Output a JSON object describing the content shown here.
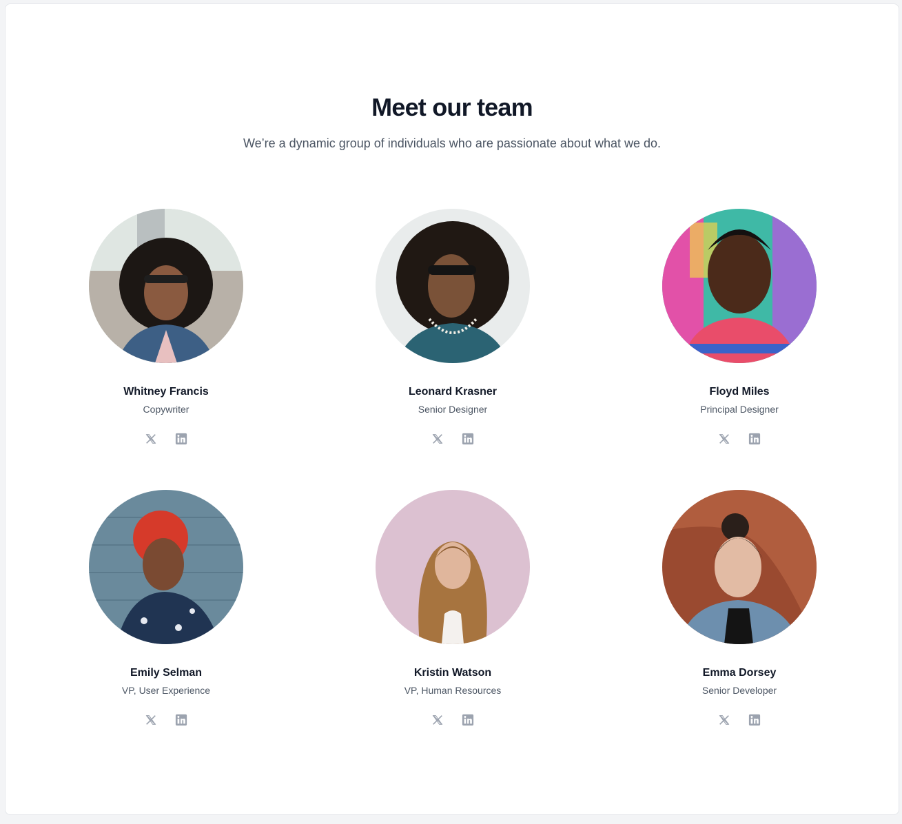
{
  "header": {
    "title": "Meet our team",
    "subtitle": "We’re a dynamic group of individuals who are passionate about what we do."
  },
  "colors": {
    "title": "#111827",
    "text": "#4b5563",
    "icon": "#9ca3af",
    "card_border": "#e5e7eb"
  },
  "icons": [
    "x-twitter-icon",
    "linkedin-icon"
  ],
  "members": [
    {
      "name": "Whitney Francis",
      "role": "Copywriter"
    },
    {
      "name": "Leonard Krasner",
      "role": "Senior Designer"
    },
    {
      "name": "Floyd Miles",
      "role": "Principal Designer"
    },
    {
      "name": "Emily Selman",
      "role": "VP, User Experience"
    },
    {
      "name": "Kristin Watson",
      "role": "VP, Human Resources"
    },
    {
      "name": "Emma Dorsey",
      "role": "Senior Developer"
    }
  ]
}
